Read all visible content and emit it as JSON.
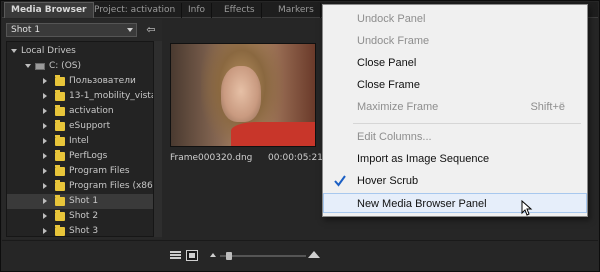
{
  "tabs": [
    {
      "label": "Media Browser",
      "active": true
    },
    {
      "label": "Project: activation",
      "active": false
    },
    {
      "label": "Info",
      "active": false
    },
    {
      "label": "Effects",
      "active": false
    },
    {
      "label": "Markers",
      "active": false
    }
  ],
  "location_dropdown": {
    "value": "Shot 1"
  },
  "tree": {
    "items": [
      {
        "label": "Local Drives",
        "type": "section",
        "expanded": true
      },
      {
        "label": "C: (OS)",
        "type": "drive",
        "expanded": true
      },
      {
        "label": "Пользователи",
        "type": "folder"
      },
      {
        "label": "13-1_mobility_vista_",
        "type": "folder"
      },
      {
        "label": "activation",
        "type": "folder"
      },
      {
        "label": "eSupport",
        "type": "folder"
      },
      {
        "label": "Intel",
        "type": "folder"
      },
      {
        "label": "PerfLogs",
        "type": "folder"
      },
      {
        "label": "Program Files",
        "type": "folder"
      },
      {
        "label": "Program Files (x86)",
        "type": "folder"
      },
      {
        "label": "Shot 1",
        "type": "folder",
        "selected": true
      },
      {
        "label": "Shot 2",
        "type": "folder"
      },
      {
        "label": "Shot 3",
        "type": "folder"
      }
    ]
  },
  "clip": {
    "name": "Frame000320.dng",
    "duration": "00:00:05:21"
  },
  "context_menu": {
    "items": [
      {
        "label": "Undock Panel",
        "enabled": false
      },
      {
        "label": "Undock Frame",
        "enabled": false
      },
      {
        "label": "Close Panel",
        "enabled": true
      },
      {
        "label": "Close Frame",
        "enabled": true
      },
      {
        "label": "Maximize Frame",
        "enabled": false,
        "shortcut": "Shift+ё"
      },
      {
        "label": "Edit Columns...",
        "enabled": false
      },
      {
        "label": "Import as Image Sequence",
        "enabled": true
      },
      {
        "label": "Hover Scrub",
        "enabled": true,
        "checked": true
      },
      {
        "label": "New Media Browser Panel",
        "enabled": true,
        "hovered": true
      }
    ]
  },
  "colors": {
    "accent_check": "#1b5fc4",
    "folder": "#e8c53a",
    "menu_hover_bg": "#e6eefa"
  }
}
